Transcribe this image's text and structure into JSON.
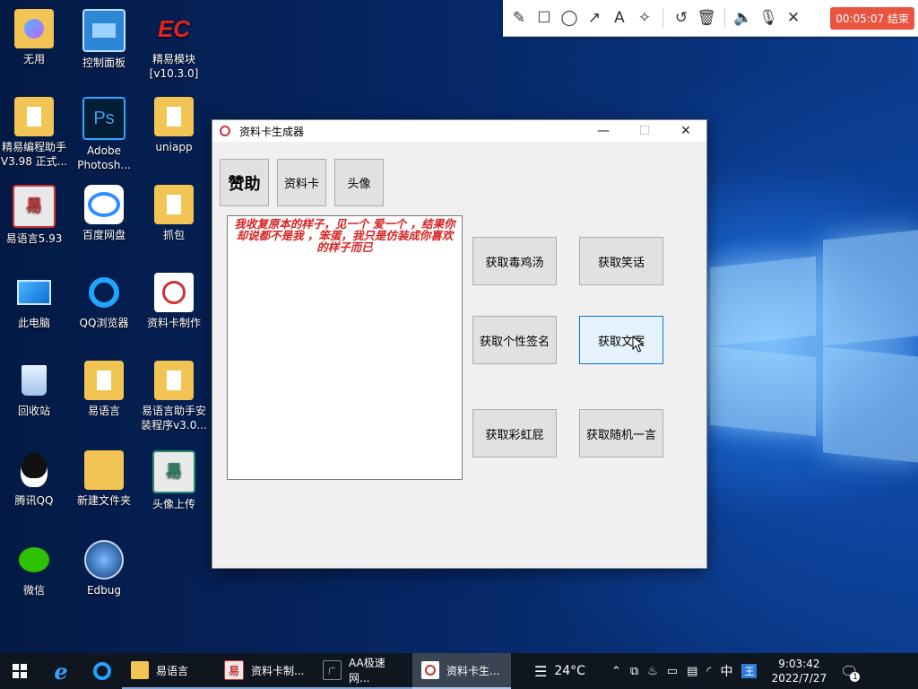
{
  "desktop": {
    "icons": [
      {
        "label": "无用"
      },
      {
        "label": "控制面板"
      },
      {
        "label": "精易模块\n[v10.3.0]",
        "badge": "EC"
      },
      {
        "label": "精易编程助手\nV3.98 正式..."
      },
      {
        "label": "Adobe\nPhotosh...",
        "badge": "Ps"
      },
      {
        "label": "uniapp"
      },
      {
        "label": "易语言5.93"
      },
      {
        "label": "百度网盘"
      },
      {
        "label": "抓包"
      },
      {
        "label": "此电脑"
      },
      {
        "label": "QQ浏览器"
      },
      {
        "label": "资料卡制作"
      },
      {
        "label": "回收站"
      },
      {
        "label": "易语言"
      },
      {
        "label": "易语言助手安\n装程序v3.0..."
      },
      {
        "label": "腾讯QQ"
      },
      {
        "label": "新建文件夹"
      },
      {
        "label": "头像上传"
      },
      {
        "label": "微信"
      },
      {
        "label": "Edbug"
      }
    ]
  },
  "recorder": {
    "stop_label": "00:05:07 结束"
  },
  "app": {
    "title": "资料卡生成器",
    "top_buttons": {
      "sponsor": "赞助",
      "profile_card": "资料卡",
      "avatar": "头像"
    },
    "text_content": "我收复原本的样子，见一个 爱一个 ，结果你却说都不是我 ，笨蛋，我只是仿装成你喜欢的样子而已",
    "action_buttons": {
      "poison_soup": "获取毒鸡汤",
      "jokes": "获取笑话",
      "signature": "获取个性签名",
      "copywriting": "获取文案",
      "rainbow_fart": "获取彩虹屁",
      "random_quote": "获取随机一言"
    }
  },
  "taskbar": {
    "apps": [
      {
        "label": "易语言"
      },
      {
        "label": "资料卡制..."
      },
      {
        "label": "AA极速网..."
      },
      {
        "label": "资料卡生..."
      }
    ],
    "weather": "24°C",
    "ime": "中",
    "time": "9:03:42",
    "date": "2022/7/27",
    "notification_count": "1"
  },
  "colors": {
    "accent": "#0078d7",
    "text_red": "#d81f1f",
    "record_stop": "#e8543f",
    "taskbar": "#101620"
  }
}
